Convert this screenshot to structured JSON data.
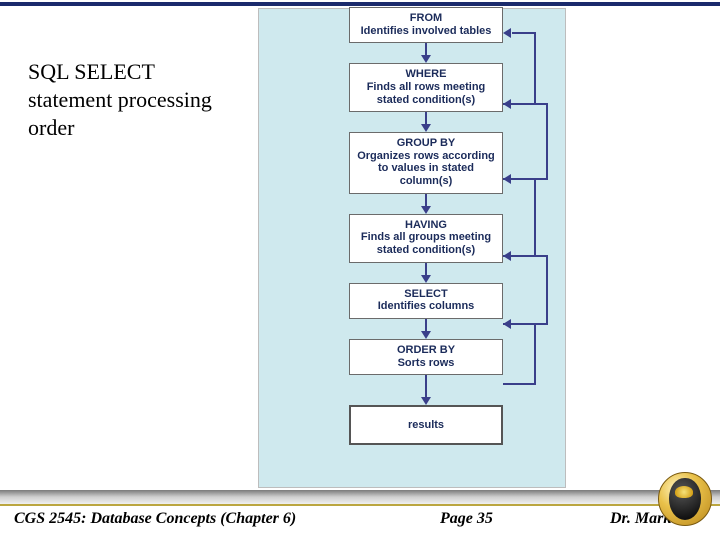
{
  "title": "SQL SELECT statement processing order",
  "diagram": {
    "steps": [
      {
        "keyword": "FROM",
        "desc": "Identifies involved tables"
      },
      {
        "keyword": "WHERE",
        "desc": "Finds all rows meeting stated condition(s)"
      },
      {
        "keyword": "GROUP BY",
        "desc": "Organizes rows according to values in stated column(s)"
      },
      {
        "keyword": "HAVING",
        "desc": "Finds all groups meeting stated condition(s)"
      },
      {
        "keyword": "SELECT",
        "desc": "Identifies columns"
      },
      {
        "keyword": "ORDER BY",
        "desc": "Sorts rows"
      }
    ],
    "result_label": "results"
  },
  "footer": {
    "left": "CGS 2545: Database Concepts  (Chapter 6)",
    "middle": "Page 35",
    "right": "Dr. Mark"
  },
  "colors": {
    "panel_bg": "#cfe9ee",
    "arrow": "#3a3f8a",
    "top_rule": "#1a2a6c"
  }
}
